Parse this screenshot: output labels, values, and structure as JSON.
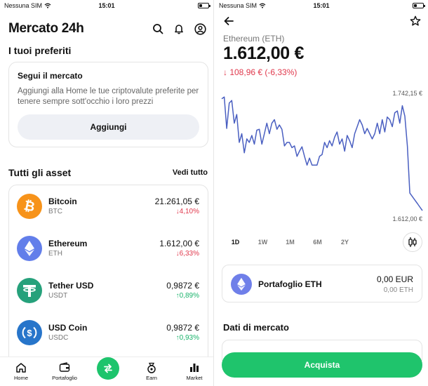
{
  "status_left": {
    "carrier": "Nessuna SIM",
    "time": "15:01"
  },
  "status_right": {
    "carrier": "Nessuna SIM",
    "time": "15:01"
  },
  "home": {
    "title": "Mercato 24h",
    "favorites_title": "I tuoi preferiti",
    "favorites_card": {
      "title": "Segui il mercato",
      "description": "Aggiungi alla Home le tue criptovalute preferite per tenere sempre sott'occhio i loro prezzi",
      "button": "Aggiungi"
    },
    "assets_title": "Tutti gli asset",
    "see_all": "Vedi tutto",
    "assets": [
      {
        "name": "Bitcoin",
        "symbol": "BTC",
        "price": "21.261,05 €",
        "change": "↓4,10%",
        "direction": "down",
        "color": "#f7931a",
        "icon": "bitcoin-icon"
      },
      {
        "name": "Ethereum",
        "symbol": "ETH",
        "price": "1.612,00 €",
        "change": "↓6,33%",
        "direction": "down",
        "color": "#627eea",
        "icon": "ethereum-icon"
      },
      {
        "name": "Tether USD",
        "symbol": "USDT",
        "price": "0,9872 €",
        "change": "↑0,89%",
        "direction": "up",
        "color": "#26a17b",
        "icon": "tether-icon"
      },
      {
        "name": "USD Coin",
        "symbol": "USDC",
        "price": "0,9872 €",
        "change": "↑0,93%",
        "direction": "up",
        "color": "#2775ca",
        "icon": "usdc-icon"
      }
    ],
    "tabs": [
      "Home",
      "Portafoglio",
      "Earn",
      "Market"
    ]
  },
  "detail": {
    "coin_name": "Ethereum (ETH)",
    "price": "1.612,00 €",
    "change": "↓ 108,96 € (-6,33%)",
    "chart_max_label": "1.742,15 €",
    "chart_min_label": "1.612,00 €",
    "ranges": [
      "1D",
      "1W",
      "1M",
      "6M",
      "2Y"
    ],
    "selected_range": "1D",
    "wallet": {
      "name": "Portafoglio ETH",
      "value": "0,00 EUR",
      "amount": "0,00 ETH"
    },
    "market_data_title": "Dati di mercato",
    "buy_button": "Acquista"
  },
  "colors": {
    "accent": "#1fc46c",
    "negative": "#e0384c",
    "positive": "#18b36a",
    "chart_line": "#4a5fc1"
  },
  "chart_data": {
    "type": "line",
    "title": "",
    "xlabel": "",
    "ylabel": "",
    "ylim": [
      1612.0,
      1742.15
    ],
    "series": [
      {
        "name": "",
        "values": [
          1740,
          1742,
          1706,
          1735,
          1738,
          1712,
          1722,
          1690,
          1700,
          1678,
          1694,
          1690,
          1698,
          1688,
          1704,
          1705,
          1688,
          1700,
          1712,
          1700,
          1712,
          1716,
          1705,
          1710,
          1705,
          1686,
          1690,
          1690,
          1684,
          1686,
          1674,
          1680,
          1685,
          1674,
          1664,
          1672,
          1664,
          1664,
          1664,
          1674,
          1676,
          1690,
          1684,
          1692,
          1686,
          1696,
          1702,
          1688,
          1694,
          1680,
          1698,
          1692,
          1684,
          1700,
          1708,
          1716,
          1710,
          1700,
          1706,
          1700,
          1694,
          1700,
          1712,
          1700,
          1716,
          1702,
          1719,
          1716,
          1708,
          1724,
          1726,
          1712,
          1732,
          1720,
          1686,
          1632,
          1628,
          1624,
          1620,
          1616,
          1612
        ]
      }
    ]
  }
}
